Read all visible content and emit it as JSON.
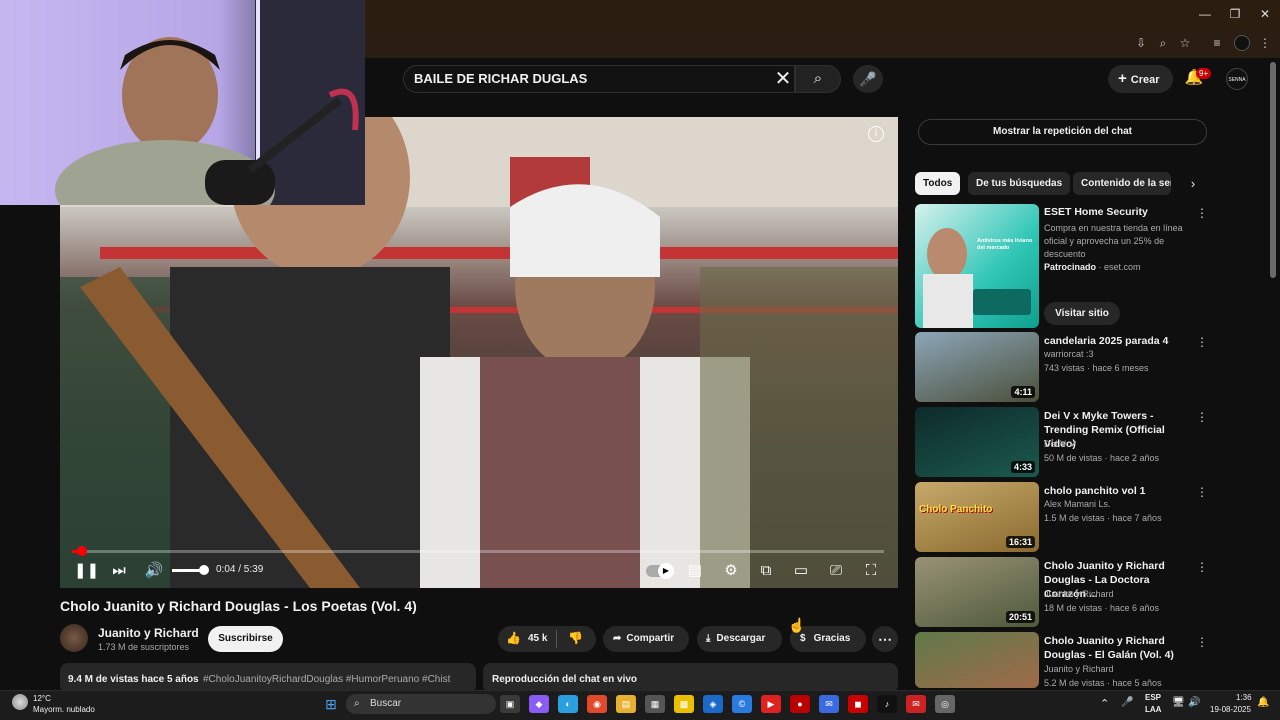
{
  "window": {
    "controls": [
      "—",
      "❐",
      "✕"
    ]
  },
  "toolbar_icons": [
    "⇩",
    "⌕",
    "☆",
    "≡",
    "⋮"
  ],
  "header": {
    "search_query": "BAILE DE RICHAR DUGLAS",
    "clear": "✕",
    "search_icon": "⌕",
    "mic_icon": "🎤",
    "create_label": "Crear",
    "notif_badge": "9+",
    "avatar_text": "SENNA"
  },
  "player": {
    "info_icon": "i",
    "progress_fraction": 0.012,
    "volume_fraction": 0.9,
    "time": "0:04 / 5:39",
    "controls": {
      "pause": "❚❚",
      "next": "⏭",
      "volume": "🔊",
      "autoplay": "▶",
      "subtitles": "▤",
      "settings": "⚙",
      "miniplayer": "⧉",
      "theater": "▭",
      "cast": "⎚",
      "fullscreen": "⛶"
    }
  },
  "video": {
    "title": "Cholo Juanito y Richard Douglas - Los Poetas (Vol. 4)",
    "channel": "Juanito y Richard",
    "subscribers": "1.73 M de suscriptores",
    "subscribe_label": "Suscribirse",
    "likes": "45 k",
    "like_icon": "👍",
    "dislike_icon": "👎",
    "share_label": "Compartir",
    "share_icon": "➦",
    "download_label": "Descargar",
    "download_icon": "⤓",
    "thanks_label": "Gracias",
    "thanks_icon": "$",
    "more": "⋯",
    "views_age": "9.4 M de vistas  hace 5 años",
    "hashtags": "#CholoJuanitoyRichardDouglas #HumorPeruano #Chist",
    "chat_live": "Reproducción del chat en vivo"
  },
  "sidebar": {
    "chat_replay": "Mostrar la repetición del chat",
    "chips": [
      "Todos",
      "De tus búsquedas",
      "Contenido de la ser"
    ],
    "chip_next": "›",
    "ad": {
      "title": "ESET Home Security",
      "body": "Compra en nuestra tienda en línea oficial y aprovecha un 25% de descuento",
      "sponsored": "Patrocinado",
      "domain": "eset.com",
      "cta": "Visitar sitio",
      "overlay_text": "Antivirus más líviano del mercado"
    },
    "videos": [
      {
        "title": "candelaria 2025 parada 4",
        "channel": "warriorcat :3",
        "meta": "743 vistas · hace 6 meses",
        "duration": "4:11",
        "color_a": "#8da6b8",
        "color_b": "#4a4f3a"
      },
      {
        "title": "Dei V x Myke Towers - Trending Remix (Official Video)",
        "channel": "Dei V",
        "verified": "✔",
        "meta": "50 M de vistas · hace 2 años",
        "duration": "4:33",
        "color_a": "#0e2a2a",
        "color_b": "#1a5a4e"
      },
      {
        "title": "cholo panchito vol  1",
        "channel": "Alex Mamani Ls.",
        "meta": "1.5 M de vistas · hace 7 años",
        "duration": "16:31",
        "color_a": "#c7a96b",
        "color_b": "#8a6a2e",
        "overlay": "Cholo Panchito"
      },
      {
        "title": "Cholo Juanito y Richard Douglas - La Doctora Corazón ...",
        "channel": "Juanito y Richard",
        "meta": "18 M de vistas · hace 6 años",
        "duration": "20:51",
        "color_a": "#9a9276",
        "color_b": "#4d5a3a"
      },
      {
        "title": "Cholo Juanito y Richard Douglas - El Galán (Vol. 4)",
        "channel": "Juanito y Richard",
        "meta": "5.2 M de vistas · hace 5 años",
        "duration": "",
        "color_a": "#5f7a4a",
        "color_b": "#a06a4a"
      }
    ],
    "more": "⋮"
  },
  "taskbar": {
    "weather_temp": "12°C",
    "weather_desc": "Mayorm. nublado",
    "search_label": "Buscar",
    "lang_line1": "ESP",
    "lang_line2": "LAA",
    "time": "1:36",
    "date": "19-08-2025",
    "start_icon": "⊞",
    "search_icon": "⌕",
    "apps": [
      "▣",
      "◆",
      "◐",
      "◉",
      "▤",
      "▦",
      "▩",
      "◈",
      "©",
      "▶",
      "●",
      "✉",
      "◼",
      "♪",
      "✉",
      "◎"
    ],
    "tray": [
      "⌃",
      "🎤",
      "🖥",
      "🔊"
    ],
    "bell_icon": "🔔"
  }
}
